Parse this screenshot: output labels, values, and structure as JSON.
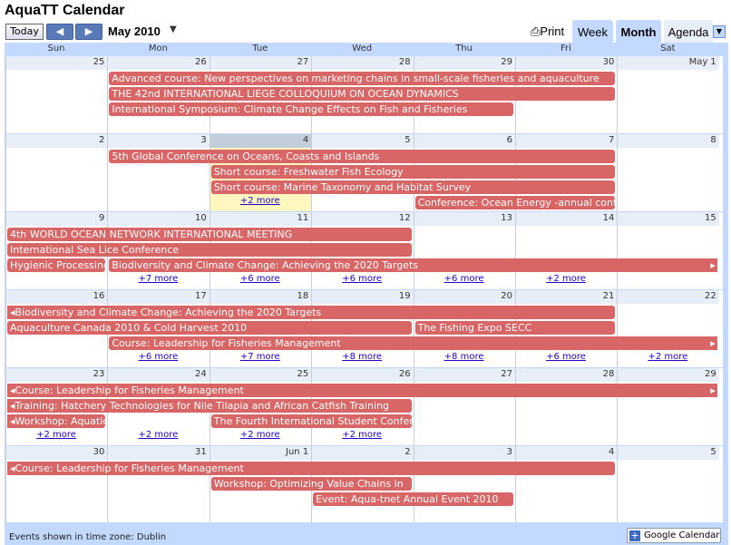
{
  "header": {
    "title": "AquaTT Calendar",
    "today_label": "Today",
    "prev_label": "◀",
    "next_label": "▶",
    "month_label": "May 2010",
    "dropdown": "▼",
    "print_label": "Print"
  },
  "tabs": {
    "week": "Week",
    "month": "Month",
    "agenda": "Agenda"
  },
  "days": [
    "Sun",
    "Mon",
    "Tue",
    "Wed",
    "Thu",
    "Fri",
    "Sat"
  ],
  "weeks": [
    {
      "dates": [
        "25",
        "26",
        "27",
        "28",
        "29",
        "30",
        "May 1"
      ]
    },
    {
      "dates": [
        "2",
        "3",
        "4",
        "5",
        "6",
        "7",
        "8"
      ]
    },
    {
      "dates": [
        "9",
        "10",
        "11",
        "12",
        "13",
        "14",
        "15"
      ]
    },
    {
      "dates": [
        "16",
        "17",
        "18",
        "19",
        "20",
        "21",
        "22"
      ]
    },
    {
      "dates": [
        "23",
        "24",
        "25",
        "26",
        "27",
        "28",
        "29"
      ]
    },
    {
      "dates": [
        "30",
        "31",
        "Jun 1",
        "2",
        "3",
        "4",
        "5"
      ]
    }
  ],
  "events": [
    {
      "w": 0,
      "s": 1,
      "e": 5,
      "r": 0,
      "t": "Advanced course: New perspectives on marketing chains in small-scale fisheries and aquaculture"
    },
    {
      "w": 0,
      "s": 1,
      "e": 5,
      "r": 1,
      "t": "THE 42nd INTERNATIONAL LIEGE COLLOQUIUM ON OCEAN DYNAMICS"
    },
    {
      "w": 0,
      "s": 1,
      "e": 4,
      "r": 2,
      "t": "International Symposium: Climate Change Effects on Fish and Fisheries"
    },
    {
      "w": 1,
      "s": 1,
      "e": 5,
      "r": 0,
      "t": "5th Global Conference on Oceans, Coasts and Islands"
    },
    {
      "w": 1,
      "s": 2,
      "e": 5,
      "r": 1,
      "t": "Short course: Freshwater Fish Ecology"
    },
    {
      "w": 1,
      "s": 2,
      "e": 5,
      "r": 2,
      "t": "Short course: Marine Taxonomy and Habitat Survey"
    },
    {
      "w": 1,
      "s": 4,
      "e": 5,
      "r": 3,
      "t": "Conference: Ocean Energy -annual conference"
    },
    {
      "w": 2,
      "s": 0,
      "e": 3,
      "r": 0,
      "t": "4th WORLD OCEAN NETWORK INTERNATIONAL MEETING"
    },
    {
      "w": 2,
      "s": 0,
      "e": 3,
      "r": 1,
      "t": "International Sea Lice Conference"
    },
    {
      "w": 2,
      "s": 0,
      "e": 0,
      "r": 2,
      "t": "Hygienic Processing"
    },
    {
      "w": 2,
      "s": 1,
      "e": 6,
      "r": 2,
      "t": "Biodiversity and Climate Change: Achieving the 2020 Targets",
      "cr": true,
      "arrowR": true
    },
    {
      "w": 3,
      "s": 0,
      "e": 5,
      "r": 0,
      "t": "Biodiversity and Climate Change: Achieving the 2020 Targets",
      "cl": true,
      "arrowL": true
    },
    {
      "w": 3,
      "s": 0,
      "e": 3,
      "r": 1,
      "t": "Aquaculture Canada 2010 & Cold Harvest 2010"
    },
    {
      "w": 3,
      "s": 4,
      "e": 5,
      "r": 1,
      "t": "The Fishing Expo SECC"
    },
    {
      "w": 3,
      "s": 1,
      "e": 6,
      "r": 2,
      "t": "Course: Leadership for Fisheries Management",
      "cr": true,
      "arrowR": true
    },
    {
      "w": 4,
      "s": 0,
      "e": 6,
      "r": 0,
      "t": "Course: Leadership for Fisheries Management",
      "cl": true,
      "cr": true,
      "arrowL": true,
      "arrowR": true
    },
    {
      "w": 4,
      "s": 0,
      "e": 3,
      "r": 1,
      "t": "Training: Hatchery Technologies for Nile Tilapia and African Catfish Training",
      "cl": true,
      "arrowL": true
    },
    {
      "w": 4,
      "s": 0,
      "e": 0,
      "r": 2,
      "t": "Workshop: Aquatic",
      "cl": true,
      "arrowL": true
    },
    {
      "w": 4,
      "s": 2,
      "e": 3,
      "r": 2,
      "t": "The Fourth International Student Conference"
    },
    {
      "w": 5,
      "s": 0,
      "e": 5,
      "r": 0,
      "t": "Course: Leadership for Fisheries Management",
      "cl": true,
      "arrowL": true
    },
    {
      "w": 5,
      "s": 2,
      "e": 3,
      "r": 1,
      "t": "Workshop: Optimizing Value Chains in"
    },
    {
      "w": 5,
      "s": 3,
      "e": 4,
      "r": 2,
      "t": "Event: Aqua-tnet Annual Event 2010"
    }
  ],
  "more": [
    {
      "w": 1,
      "c": 2,
      "t": "+2 more"
    },
    {
      "w": 2,
      "c": 1,
      "t": "+7 more"
    },
    {
      "w": 2,
      "c": 2,
      "t": "+6 more"
    },
    {
      "w": 2,
      "c": 3,
      "t": "+6 more"
    },
    {
      "w": 2,
      "c": 4,
      "t": "+6 more"
    },
    {
      "w": 2,
      "c": 5,
      "t": "+2 more"
    },
    {
      "w": 3,
      "c": 1,
      "t": "+6 more"
    },
    {
      "w": 3,
      "c": 2,
      "t": "+7 more"
    },
    {
      "w": 3,
      "c": 3,
      "t": "+8 more"
    },
    {
      "w": 3,
      "c": 4,
      "t": "+8 more"
    },
    {
      "w": 3,
      "c": 5,
      "t": "+6 more"
    },
    {
      "w": 3,
      "c": 6,
      "t": "+2 more"
    },
    {
      "w": 4,
      "c": 0,
      "t": "+2 more"
    },
    {
      "w": 4,
      "c": 1,
      "t": "+2 more"
    },
    {
      "w": 4,
      "c": 2,
      "t": "+2 more"
    },
    {
      "w": 4,
      "c": 3,
      "t": "+2 more"
    }
  ],
  "today": {
    "w": 1,
    "c": 2
  },
  "footer": {
    "timezone": "Events shown in time zone: Dublin",
    "badge": "Google Calendar",
    "badge_plus": "+"
  },
  "colors": {
    "event": "#d96666",
    "frame": "#c3d9ff",
    "today": "#fff7c0"
  }
}
